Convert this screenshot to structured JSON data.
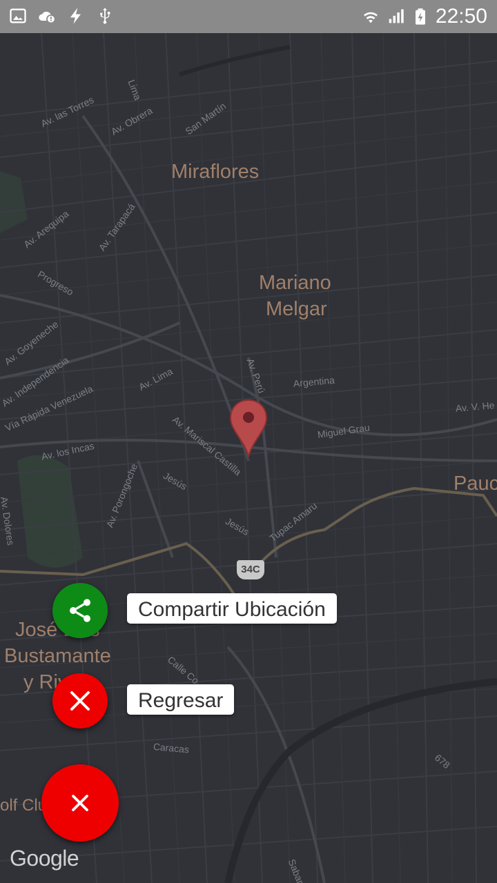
{
  "status_bar": {
    "left_icons": [
      "image-icon",
      "cloud-alert-icon",
      "flash-icon",
      "usb-icon"
    ],
    "right_icons": [
      "wifi-icon",
      "signal-icon",
      "battery-charging-icon"
    ],
    "time": "22:50"
  },
  "map": {
    "places": {
      "miraflores": "Miraflores",
      "mariano_1": "Mariano",
      "mariano_2": "Melgar",
      "jose_1": "José Luis",
      "jose_2": "Bustamante",
      "jose_3": "y Rivero",
      "pau": "Pauc",
      "golf": "olf Clu"
    },
    "streets": {
      "torres": "Av. las Torres",
      "obrera": "Av. Obrera",
      "lima_top": "Lima",
      "sanmartin": "San Martín",
      "arequipa": "Av. Arequipa",
      "tarapaca": "Av. Tarapacá",
      "progreso": "Progreso",
      "goyeneche": "Av. Goyeneche",
      "independencia": "Av. Independencia",
      "venezuela": "Vía Rápida Venezuela",
      "lima": "Av. Lima",
      "peru": "Av. Perú",
      "argentina": "Argentina",
      "vhe": "Av. V. He",
      "miguelgrau": "Miguel Grau",
      "castilla": "Av. Mariscal Castilla",
      "incas": "Av. los Incas",
      "porongoche": "Av. Porongoche",
      "jesus1": "Jesús",
      "jesus2": "Jesús",
      "tupac": "Tupac Amaru",
      "dolores": "Av. Dolores",
      "calle": "Calle Co",
      "caracas": "Caracas",
      "sabandia": "Sabandía",
      "n678": "678"
    },
    "highway_shield": "34C",
    "attribution": "Google"
  },
  "fab_menu": {
    "share_label": "Compartir Ubicación",
    "back_label": "Regresar",
    "colors": {
      "share": "#0d8b16",
      "close": "#ee0000"
    }
  }
}
